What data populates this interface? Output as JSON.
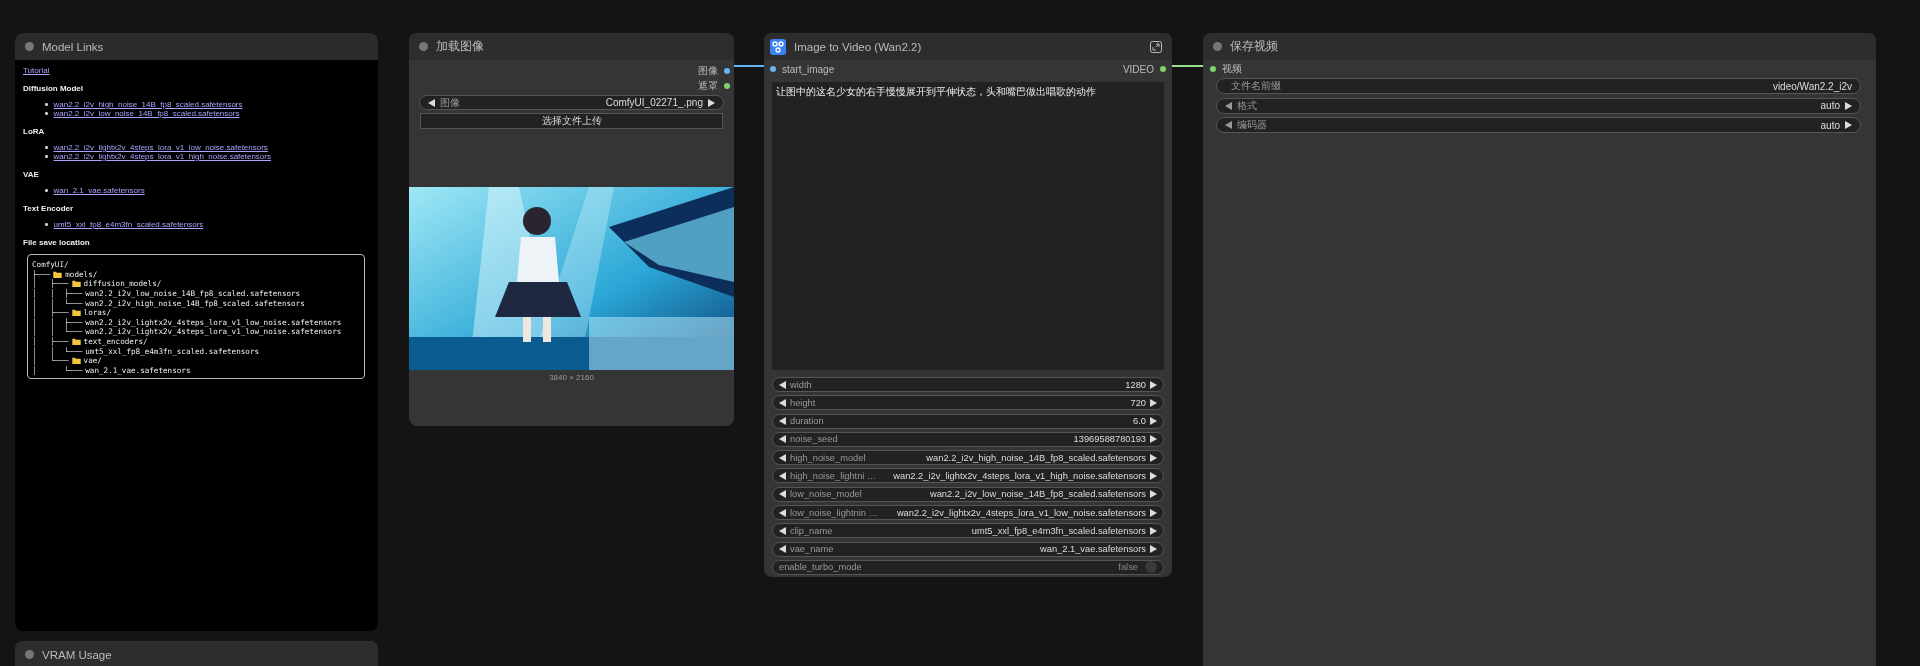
{
  "model_links": {
    "title": "Model Links",
    "tutorial": "Tutorial",
    "sections": [
      {
        "heading": "Diffusion Model",
        "links": [
          "wan2.2_i2v_high_noise_14B_fp8_scaled.safetensors",
          "wan2.2_i2v_low_noise_14B_fp8_scaled.safetensors"
        ]
      },
      {
        "heading": "LoRA",
        "links": [
          "wan2.2_i2v_lightx2v_4steps_lora_v1_low_noise.safetensors",
          "wan2.2_i2v_lightx2v_4steps_lora_v1_high_noise.safetensors"
        ]
      },
      {
        "heading": "VAE",
        "links": [
          "wan_2.1_vae.safetensors"
        ]
      },
      {
        "heading": "Text Encoder",
        "links": [
          "umt5_xxl_fp8_e4m3fn_scaled.safetensors"
        ]
      }
    ],
    "save_heading": "File save location",
    "tree": [
      {
        "kind": "root",
        "name": "ComfyUI/"
      },
      {
        "branch": "├───",
        "kind": "folder",
        "name": "models/"
      },
      {
        "branch": "│   ├───",
        "kind": "folder",
        "name": "diffusion_models/"
      },
      {
        "branch": "│   │  ├───",
        "kind": "file",
        "name": "wan2.2_i2v_low_noise_14B_fp8_scaled.safetensors"
      },
      {
        "branch": "│   │  └───",
        "kind": "file",
        "name": "wan2.2_i2v_high_noise_14B_fp8_scaled.safetensors"
      },
      {
        "branch": "│   ├───",
        "kind": "folder",
        "name": "loras/"
      },
      {
        "branch": "│   │  ├───",
        "kind": "file",
        "name": "wan2.2_i2v_lightx2v_4steps_lora_v1_low_noise.safetensors"
      },
      {
        "branch": "│   │  └───",
        "kind": "file",
        "name": "wan2.2_i2v_lightx2v_4steps_lora_v1_low_noise.safetensors"
      },
      {
        "branch": "│   ├───",
        "kind": "folder",
        "name": "text_encoders/"
      },
      {
        "branch": "│   │  └───",
        "kind": "file",
        "name": "umt5_xxl_fp8_e4m3fn_scaled.safetensors"
      },
      {
        "branch": "│   └───",
        "kind": "folder",
        "name": "vae/"
      },
      {
        "branch": "│      └───",
        "kind": "file",
        "name": "wan_2.1_vae.safetensors"
      }
    ]
  },
  "vram_node": {
    "title": "VRAM Usage"
  },
  "load_image": {
    "title": "加载图像",
    "outputs": [
      {
        "label": "图像",
        "color": "#64b5f6"
      },
      {
        "label": "遮罩",
        "color": "#7ed36b"
      }
    ],
    "image_widget": {
      "label": "图像",
      "value": "ComfyUI_02271_.png"
    },
    "upload_button": "选择文件上传",
    "image_size": "3840 × 2160"
  },
  "image_to_video": {
    "title": "Image to Video (Wan2.2)",
    "input": "start_image",
    "output": "VIDEO",
    "prompt": "让图中的这名少女的右手慢慢展开到平伸状态，头和嘴巴做出唱歌的动作",
    "widgets": [
      {
        "kind": "number",
        "label": "width",
        "value": "1280"
      },
      {
        "kind": "number",
        "label": "height",
        "value": "720"
      },
      {
        "kind": "number",
        "label": "duration",
        "value": "6.0"
      },
      {
        "kind": "number",
        "label": "noise_seed",
        "value": "13969588780193"
      },
      {
        "kind": "combo",
        "label": "high_noise_model",
        "value": "wan2.2_i2v_high_noise_14B_fp8_scaled.safetensors"
      },
      {
        "kind": "combo",
        "label": "high_noise_lightni …",
        "value": "wan2.2_i2v_lightx2v_4steps_lora_v1_high_noise.safetensors"
      },
      {
        "kind": "combo",
        "label": "low_noise_model",
        "value": "wan2.2_i2v_low_noise_14B_fp8_scaled.safetensors"
      },
      {
        "kind": "combo",
        "label": "low_noise_lightnin …",
        "value": "wan2.2_i2v_lightx2v_4steps_lora_v1_low_noise.safetensors"
      },
      {
        "kind": "combo",
        "label": "clip_name",
        "value": "umt5_xxl_fp8_e4m3fn_scaled.safetensors"
      },
      {
        "kind": "combo",
        "label": "vae_name",
        "value": "wan_2.1_vae.safetensors"
      },
      {
        "kind": "toggle",
        "label": "enable_turbo_mode",
        "value": "false",
        "on": false
      }
    ]
  },
  "save_video": {
    "title": "保存视频",
    "input": "视频",
    "widgets": [
      {
        "kind": "text",
        "label": "文件名前缀",
        "value": "video/Wan2.2_i2v"
      },
      {
        "kind": "combo",
        "label": "格式",
        "value": "auto"
      },
      {
        "kind": "combo",
        "label": "编码器",
        "value": "auto"
      }
    ]
  }
}
